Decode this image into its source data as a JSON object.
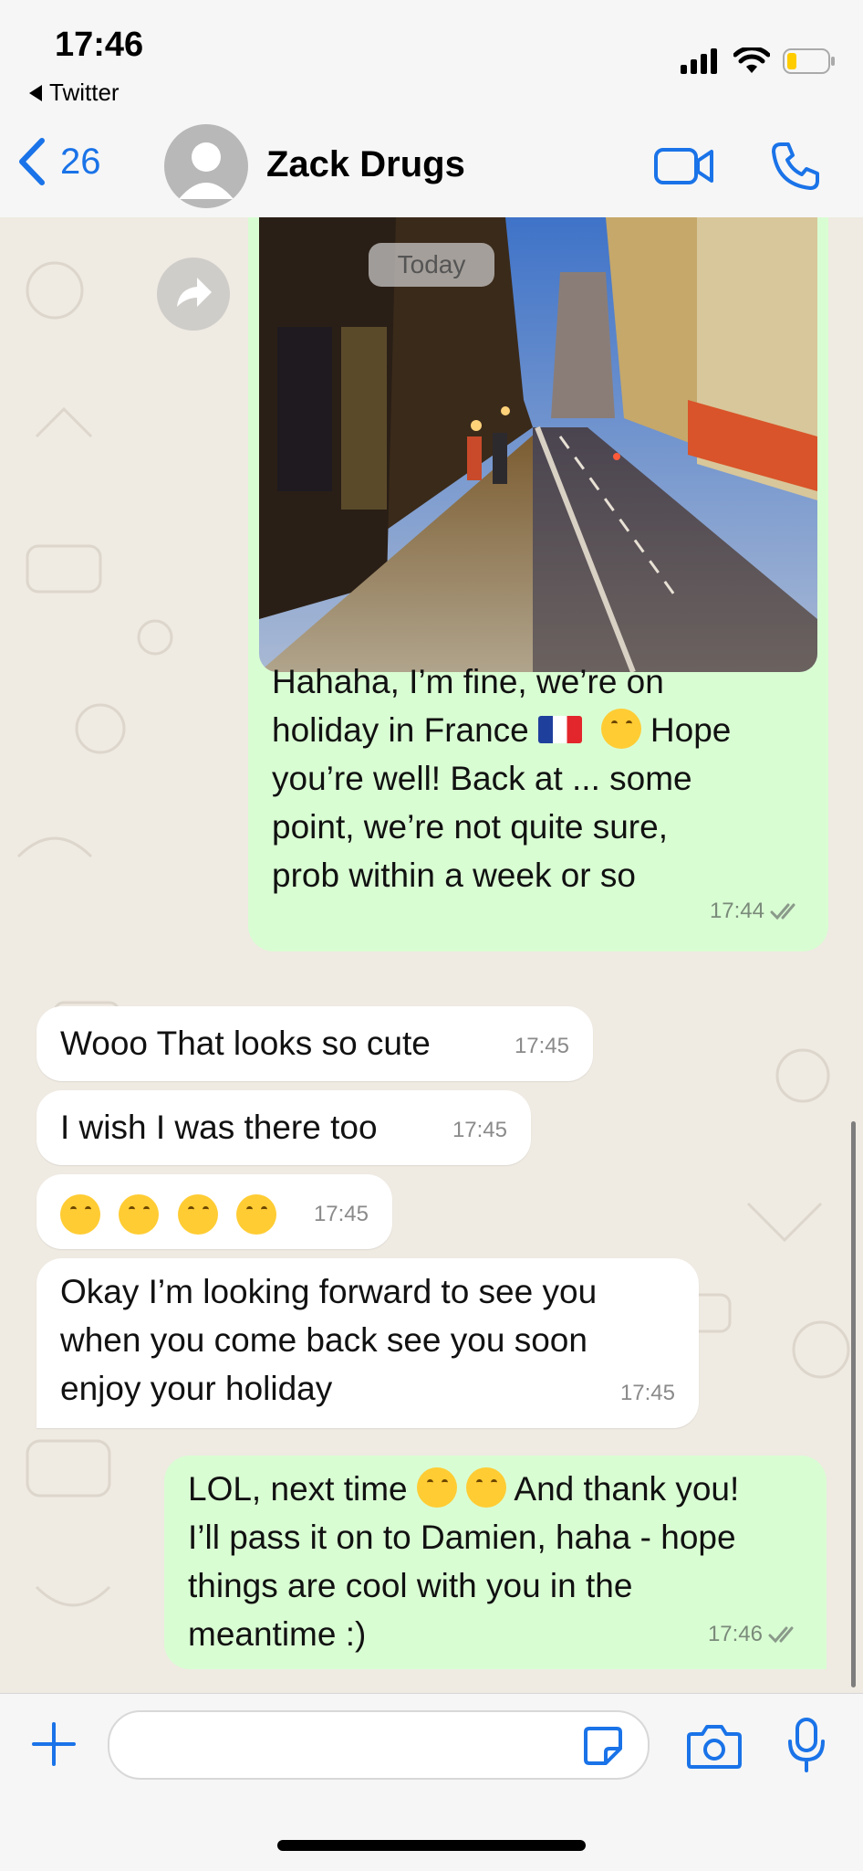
{
  "status": {
    "time": "17:46",
    "back_app": "Twitter"
  },
  "header": {
    "back_count": "26",
    "contact_name": "Zack Drugs"
  },
  "chat": {
    "date_pill": "Today",
    "messages": [
      {
        "dir": "out",
        "text_lines": [
          "Hahaha, I’m fine, we’re on",
          "holiday in France",
          "Hope",
          "you’re well! Back at ... some",
          "point, we’re not quite sure,",
          "prob within a week or so"
        ],
        "time": "17:44"
      },
      {
        "dir": "in",
        "text": "Wooo That looks so cute",
        "time": "17:45"
      },
      {
        "dir": "in",
        "text": "I wish I was there too",
        "time": "17:45"
      },
      {
        "dir": "in",
        "emoji_count": 4,
        "time": "17:45"
      },
      {
        "dir": "in",
        "text_lines": [
          "Okay I’m looking forward to see you",
          "when you come back see you soon",
          "enjoy your holiday"
        ],
        "time": "17:45"
      },
      {
        "dir": "out",
        "text_lines": [
          "LOL, next time",
          "And thank you!",
          "I’ll pass it on to Damien, haha - hope",
          "things are cool with you in the",
          "meantime :)"
        ],
        "time": "17:46"
      }
    ]
  },
  "colors": {
    "accent": "#1a73e8",
    "outgoing": "#d9fdd3",
    "incoming": "#ffffff",
    "wallpaper": "#efeae2"
  }
}
